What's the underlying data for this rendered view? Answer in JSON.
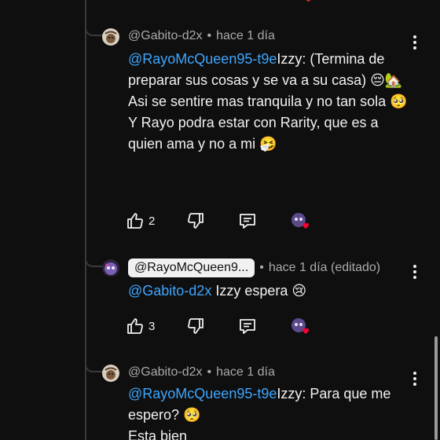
{
  "comments": [
    {
      "author": "@Gabito-d2x",
      "time": "hace 1 día",
      "mention": "@RayoMcQueen95-t9e",
      "lines": [
        "Izzy: (Termina de preparar sus cosas y se va a su casa) 😔🏡",
        "Asi se sentire mas tranquila y no tan sola 🥺",
        "Y Rayo podra estar con Rarity, que es a quien ama y no a mi 🤧"
      ],
      "likes": "2"
    },
    {
      "author_chip": "@RayoMcQueen9...",
      "time": "hace 1 día (editado)",
      "mention": "@Gabito-d2x",
      "lines": [
        " Izzy espera 😢"
      ],
      "likes": "3"
    },
    {
      "author": "@Gabito-d2x",
      "time": "hace 1 día",
      "mention": "@RayoMcQueen95-t9e",
      "lines": [
        "Izzy: Para que me espero? 🥺",
        "Esta bien"
      ]
    }
  ],
  "icons": {
    "like": "thumbs-up-icon",
    "dislike": "thumbs-down-icon",
    "reply": "reply-comment-icon",
    "menu": "more-vert-icon",
    "heart": "creator-heart-icon"
  },
  "colors": {
    "background": "#0f0f0f",
    "mention": "#3ea6ff",
    "text": "#f1f1f1",
    "meta": "#aaaaaa",
    "heart": "#ff0033"
  }
}
